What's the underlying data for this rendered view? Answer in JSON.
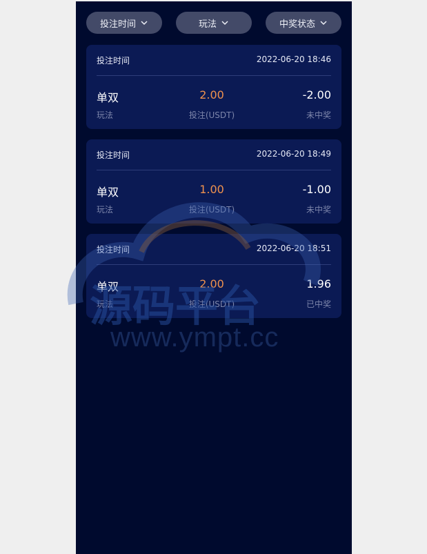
{
  "filters": [
    {
      "label": "投注时间"
    },
    {
      "label": "玩法"
    },
    {
      "label": "中奖状态"
    }
  ],
  "cards": [
    {
      "header_label": "投注时间",
      "time": "2022-06-20 18:46",
      "play": "单双",
      "play_label": "玩法",
      "bet": "2.00",
      "bet_label": "投注(USDT)",
      "result": "-2.00",
      "status": "未中奖"
    },
    {
      "header_label": "投注时间",
      "time": "2022-06-20 18:49",
      "play": "单双",
      "play_label": "玩法",
      "bet": "1.00",
      "bet_label": "投注(USDT)",
      "result": "-1.00",
      "status": "未中奖"
    },
    {
      "header_label": "投注时间",
      "time": "2022-06-20 18:51",
      "play": "单双",
      "play_label": "玩法",
      "bet": "2.00",
      "bet_label": "投注(USDT)",
      "result": "1.96",
      "status": "已中奖"
    }
  ],
  "watermark": {
    "title": "源码平台",
    "url": "www.ympt.cc"
  }
}
